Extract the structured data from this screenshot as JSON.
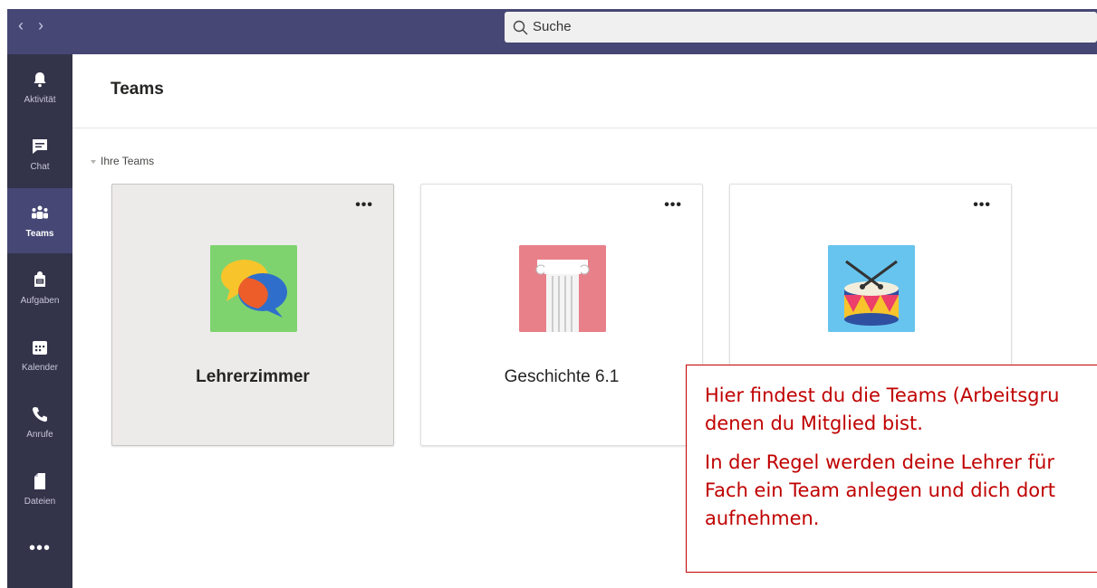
{
  "topbar": {
    "back_arrow": "‹",
    "forward_arrow": "›",
    "search_placeholder": "Suche",
    "color": "#464775"
  },
  "rail": {
    "items": [
      {
        "label": "Aktivität",
        "icon": "bell-icon"
      },
      {
        "label": "Chat",
        "icon": "chat-icon"
      },
      {
        "label": "Teams",
        "icon": "teams-icon",
        "active": true
      },
      {
        "label": "Aufgaben",
        "icon": "backpack-icon"
      },
      {
        "label": "Kalender",
        "icon": "calendar-icon"
      },
      {
        "label": "Anrufe",
        "icon": "phone-icon"
      },
      {
        "label": "Dateien",
        "icon": "file-icon"
      }
    ],
    "more": "•••",
    "color": "#33344a"
  },
  "header": {
    "title": "Teams"
  },
  "section": {
    "label": "Ihre Teams"
  },
  "teams": [
    {
      "name": "Lehrerzimmer",
      "icon": "speech-bubbles-icon",
      "tile_color": "#7ed36f",
      "selected": true,
      "more": "•••"
    },
    {
      "name": "Geschichte 6.1",
      "icon": "column-icon",
      "tile_color": "#e8808a",
      "more": "•••"
    },
    {
      "name": "",
      "icon": "drum-icon",
      "tile_color": "#67c4ef",
      "more": "•••"
    }
  ],
  "callout": {
    "line1": "Hier findest du die Teams (Arbeitsgru",
    "line2": "denen du Mitglied bist.",
    "line3": "In der Regel werden deine Lehrer für",
    "line4": "Fach ein Team anlegen und dich dort",
    "line5": "aufnehmen.",
    "color": "#c00000"
  }
}
